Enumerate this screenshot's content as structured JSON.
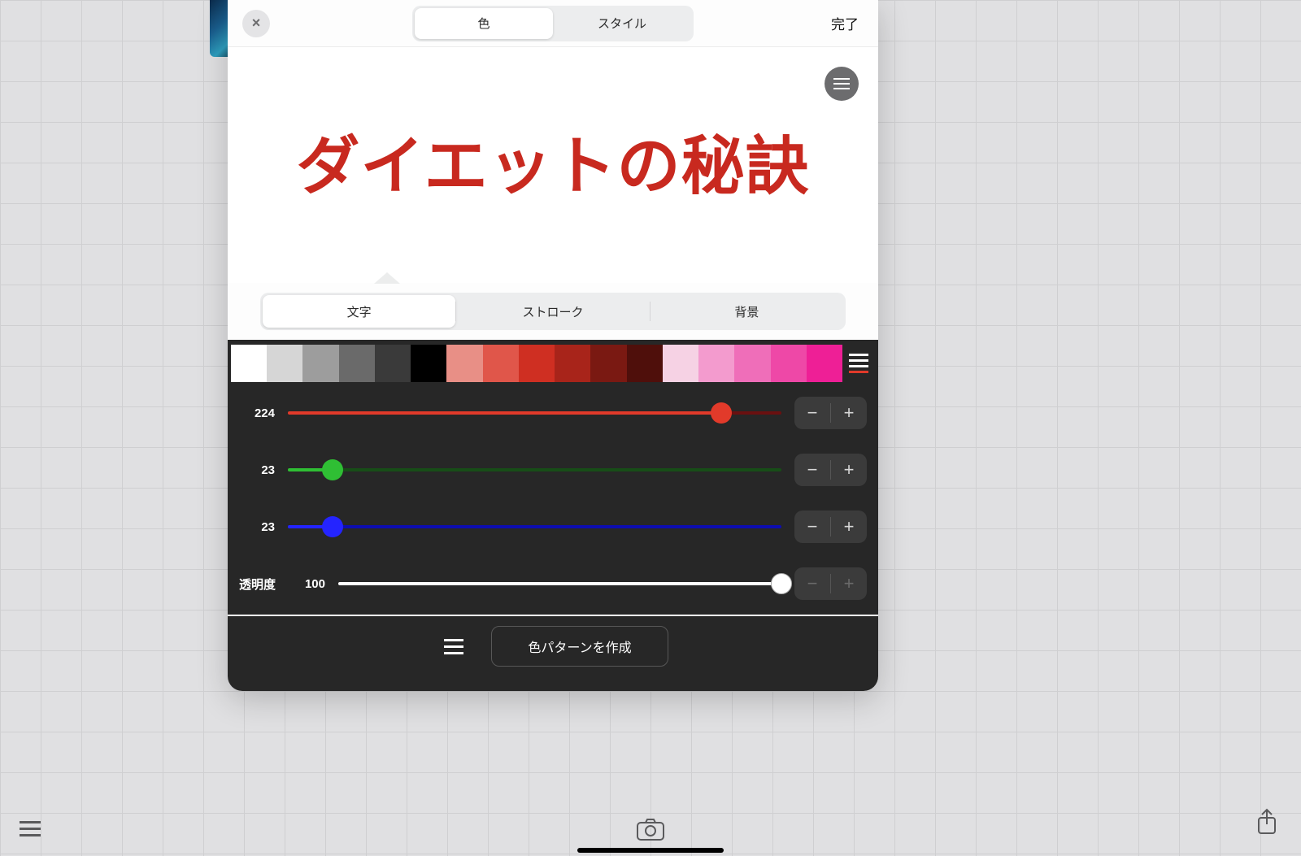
{
  "header": {
    "close_icon": "×",
    "tabs": [
      "色",
      "スタイル"
    ],
    "active_tab": 0,
    "done_label": "完了"
  },
  "preview": {
    "text": "ダイエットの秘訣",
    "text_color": "#c8291f"
  },
  "sub_tabs": {
    "items": [
      "文字",
      "ストローク",
      "背景"
    ],
    "active": 0
  },
  "swatches": [
    "#ffffff",
    "#d6d6d6",
    "#9d9d9d",
    "#6a6a6a",
    "#3a3a3a",
    "#000000",
    "#e88f86",
    "#e0564a",
    "#cf2f22",
    "#a8241a",
    "#7a1912",
    "#4f0f0b",
    "#f6d2e4",
    "#f39bce",
    "#ef6eb9",
    "#ee48a7",
    "#ee1f96"
  ],
  "sliders": {
    "r": {
      "value": 224,
      "max": 255
    },
    "g": {
      "value": 23,
      "max": 255
    },
    "b": {
      "value": 23,
      "max": 255
    },
    "opacity": {
      "label": "透明度",
      "value": 100,
      "max": 100
    }
  },
  "footer": {
    "create_label": "色パターンを作成"
  }
}
